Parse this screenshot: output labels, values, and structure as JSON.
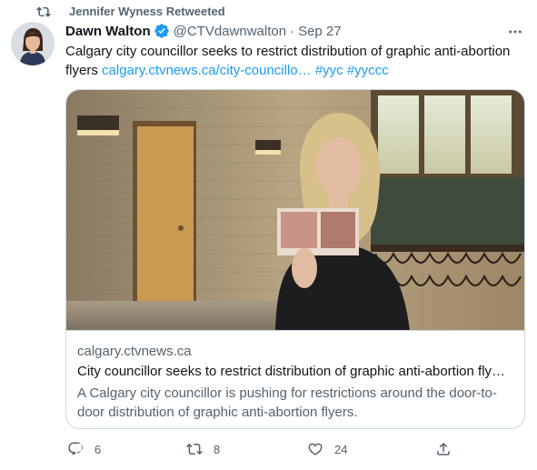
{
  "retweet": {
    "icon": "retweet-icon",
    "text": "Jennifer Wyness Retweeted"
  },
  "tweet": {
    "author_name": "Dawn Walton",
    "verified": true,
    "handle": "@CTVdawnwalton",
    "separator": "·",
    "time": "Sep 27",
    "text_plain": "Calgary city councillor seeks to restrict distribution of graphic anti-abortion flyers ",
    "text_link": "calgary.ctvnews.ca/city-councillo…",
    "hashtags": [
      "#yyc",
      "#yyccc"
    ]
  },
  "card": {
    "domain": "calgary.ctvnews.ca",
    "title": "City councillor seeks to restrict distribution of graphic anti-abortion fly…",
    "description": "A Calgary city councillor is pushing for restrictions around the door-to-door distribution of graphic anti-abortion flyers."
  },
  "actions": {
    "replies": "6",
    "retweets": "8",
    "likes": "24"
  },
  "colors": {
    "accent": "#1d9bf0",
    "text_primary": "#0f1419",
    "text_secondary": "#536471",
    "border": "#cfd9de"
  }
}
